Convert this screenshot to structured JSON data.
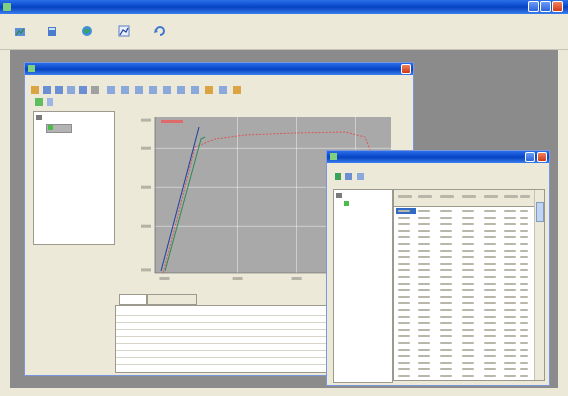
{
  "main_window": {
    "title": "",
    "menu": [
      {
        "label": ""
      },
      {
        "label": ""
      },
      {
        "label": ""
      }
    ],
    "toolbar": [
      {
        "icon": "folder-chart-icon",
        "label": ""
      },
      {
        "icon": "database-icon",
        "label": ""
      },
      {
        "icon": "globe-icon",
        "label": ""
      },
      {
        "icon": "chart-icon",
        "label": ""
      },
      {
        "icon": "refresh-icon",
        "label": ""
      }
    ]
  },
  "chart_window": {
    "title": "",
    "menu": [
      {
        "label": ""
      },
      {
        "label": ""
      },
      {
        "label": ""
      },
      {
        "label": ""
      },
      {
        "label": ""
      }
    ],
    "tree_root": "",
    "tabs": [
      {
        "label": ""
      },
      {
        "label": ""
      }
    ],
    "property_rows": [
      {
        "label": ""
      },
      {
        "label": ""
      },
      {
        "label": ""
      },
      {
        "label": ""
      },
      {
        "label": ""
      },
      {
        "label": ""
      },
      {
        "label": ""
      },
      {
        "label": ""
      },
      {
        "label": ""
      }
    ]
  },
  "table_window": {
    "title": "",
    "menu": [
      {
        "label": ""
      },
      {
        "label": ""
      }
    ],
    "tree_root": "",
    "tree_child": ""
  },
  "colors": {
    "plot_bg": "#a9a9a9",
    "curve_a": "#1f3f9e",
    "curve_b": "#2e8b57",
    "curve_c": "#e05050",
    "title_blue": "#0a48cc",
    "window_face": "#ece9d8"
  }
}
